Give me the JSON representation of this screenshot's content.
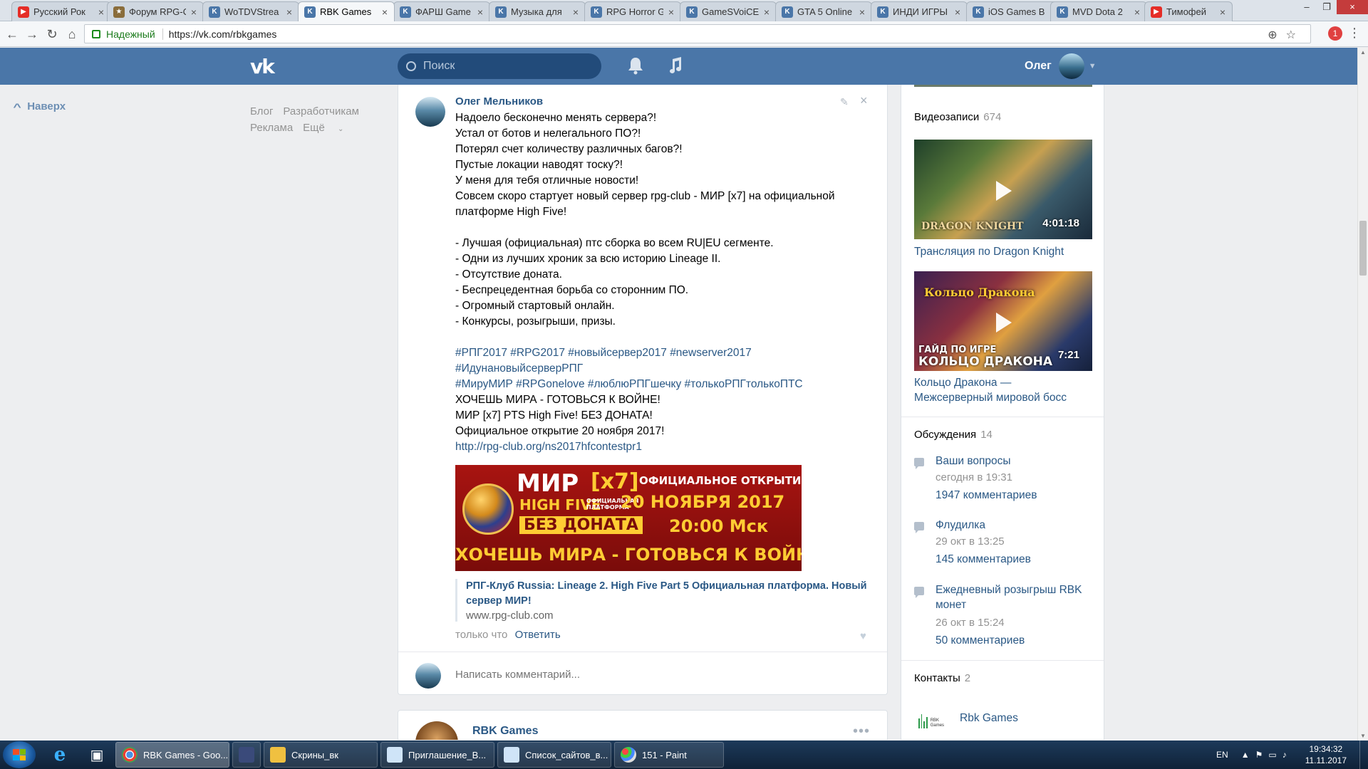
{
  "browser": {
    "tabs": [
      {
        "label": "Русский Рок",
        "icon": "youtube-icon",
        "active": false
      },
      {
        "label": "Форум RPG-C",
        "icon": "forum-icon",
        "active": false
      },
      {
        "label": "WoTDVStrea",
        "icon": "vk-icon",
        "active": false
      },
      {
        "label": "RBK Games",
        "icon": "vk-icon",
        "active": true
      },
      {
        "label": "ФАРШ Game",
        "icon": "vk-icon",
        "active": false
      },
      {
        "label": "Музыка для",
        "icon": "vk-icon",
        "active": false
      },
      {
        "label": "RPG Horror G",
        "icon": "vk-icon",
        "active": false
      },
      {
        "label": "GameSVoiCE",
        "icon": "vk-icon",
        "active": false
      },
      {
        "label": "GTA 5 Online",
        "icon": "vk-icon",
        "active": false
      },
      {
        "label": "ИНДИ ИГРЫ",
        "icon": "vk-icon",
        "active": false
      },
      {
        "label": "iOS Games B",
        "icon": "vk-icon",
        "active": false
      },
      {
        "label": "MVD Dota 2",
        "icon": "vk-icon",
        "active": false
      },
      {
        "label": "Тимофей",
        "icon": "youtube-icon",
        "active": false
      }
    ],
    "secure_label": "Надежный",
    "url": "https://vk.com/rbkgames",
    "extension_badge": "1"
  },
  "vk": {
    "search_placeholder": "Поиск",
    "user_name": "Олег",
    "back_to_top": "Наверх",
    "footer_links": [
      "Блог",
      "Разработчикам",
      "Реклама",
      "Ещё"
    ]
  },
  "post": {
    "author": "Олег Мельников",
    "lines": [
      {
        "text": "Надоело бесконечно менять сервера?!",
        "kind": "text"
      },
      {
        "text": "Устал от ботов и нелегального ПО?!",
        "kind": "text"
      },
      {
        "text": "Потерял счет количеству различных багов?!",
        "kind": "text"
      },
      {
        "text": "Пустые локации наводят тоску?!",
        "kind": "text"
      },
      {
        "text": "У меня для тебя отличные новости!",
        "kind": "text"
      },
      {
        "text": "Совсем скоро стартует новый сервер rpg-club - МИР [x7] на официальной",
        "kind": "text"
      },
      {
        "text": "платформе High Five!",
        "kind": "text"
      },
      {
        "text": "",
        "kind": "text"
      },
      {
        "text": "- Лучшая (официальная) птс сборка во всем RU|EU сегменте.",
        "kind": "text"
      },
      {
        "text": "- Одни из лучших хроник за всю историю Lineage II.",
        "kind": "text"
      },
      {
        "text": "- Отсутствие доната.",
        "kind": "text"
      },
      {
        "text": "- Беспрецедентная борьба со сторонним ПО.",
        "kind": "text"
      },
      {
        "text": "- Огромный стартовый онлайн.",
        "kind": "text"
      },
      {
        "text": "- Конкурсы, розыгрыши, призы.",
        "kind": "text"
      },
      {
        "text": "",
        "kind": "text"
      },
      {
        "text": "#РПГ2017 #RPG2017 #новыйсервер2017 #newserver2017",
        "kind": "tag"
      },
      {
        "text": "#ИдунановыйсерверРПГ",
        "kind": "tag"
      },
      {
        "text": "#МируМИР #RPGonelove #люблюРПГшечку #толькоРПГтолькоПТС",
        "kind": "tag"
      },
      {
        "text": "ХОЧЕШЬ МИРА - ГОТОВЬСЯ К ВОЙНЕ!",
        "kind": "text"
      },
      {
        "text": "МИР [x7] PTS High Five! БЕЗ ДОНАТА!",
        "kind": "text"
      },
      {
        "text": "Официальное открытие 20 ноября 2017!",
        "kind": "text"
      },
      {
        "text": "http://rpg-club.org/ns2017hfcontestpr1",
        "kind": "link"
      }
    ],
    "banner": {
      "mir": "МИР",
      "x7": "[x7]",
      "high_five": "HIGH FIVE",
      "platform": "ОФИЦИАЛЬНАЯ ПЛАТФОРМА",
      "opening": "ОФИЦИАЛЬНОЕ ОТКРЫТИЕ",
      "date": "20 НОЯБРЯ 2017",
      "no_donate": "БЕЗ ДОНАТА",
      "time": "20:00 Мск",
      "slogan": "ХОЧЕШЬ МИРА - ГОТОВЬСЯ К ВОЙНЕ"
    },
    "link_title": "РПГ-Клуб Russia: Lineage 2. High Five Part 5 Официальная платформа. Новый сервер МИР!",
    "link_domain": "www.rpg-club.com",
    "time": "только что",
    "reply_label": "Ответить",
    "comment_placeholder": "Написать комментарий..."
  },
  "next_post": {
    "author": "RBK Games"
  },
  "sidebar": {
    "videos_title": "Видеозаписи",
    "videos_count": "674",
    "videos": [
      {
        "title": "Трансляция по Dragon Knight",
        "duration": "4:01:18",
        "logo": "DRAGON KNIGHT"
      },
      {
        "title": "Кольцо Дракона — Межсерверный мировой босс",
        "duration": "7:21",
        "brand": "Кольцо Дракона",
        "guide_top": "ГАЙД ПО ИГРЕ",
        "guide_big": "КОЛЬЦО ДРАКОНА"
      }
    ],
    "discussions_title": "Обсуждения",
    "discussions_count": "14",
    "discussions": [
      {
        "title": "Ваши вопросы",
        "date": "сегодня в 19:31",
        "comments": "1947 комментариев"
      },
      {
        "title": "Флудилка",
        "date": "29 окт в 13:25",
        "comments": "145 комментариев"
      },
      {
        "title": "Ежедневный розыгрыш RBK монет",
        "date": "26 окт в 15:24",
        "comments": "50 комментариев"
      }
    ],
    "contacts_title": "Контакты",
    "contacts_count": "2",
    "contact_logo_text": "RBK Games",
    "contact_name": "Rbk Games"
  },
  "taskbar": {
    "tasks": [
      {
        "label": "RBK Games - Goo...",
        "active": true
      },
      {
        "label": "",
        "active": false
      },
      {
        "label": "Скрины_вк",
        "active": false
      },
      {
        "label": "Приглашение_В...",
        "active": false
      },
      {
        "label": "Список_сайтов_в...",
        "active": false
      },
      {
        "label": "151 - Paint",
        "active": false
      }
    ],
    "lang": "EN",
    "time": "19:34:32",
    "date": "11.11.2017"
  },
  "colors": {
    "vk_header": "#4a76a8",
    "vk_link": "#2a5885",
    "page_bg": "#edeef0"
  }
}
